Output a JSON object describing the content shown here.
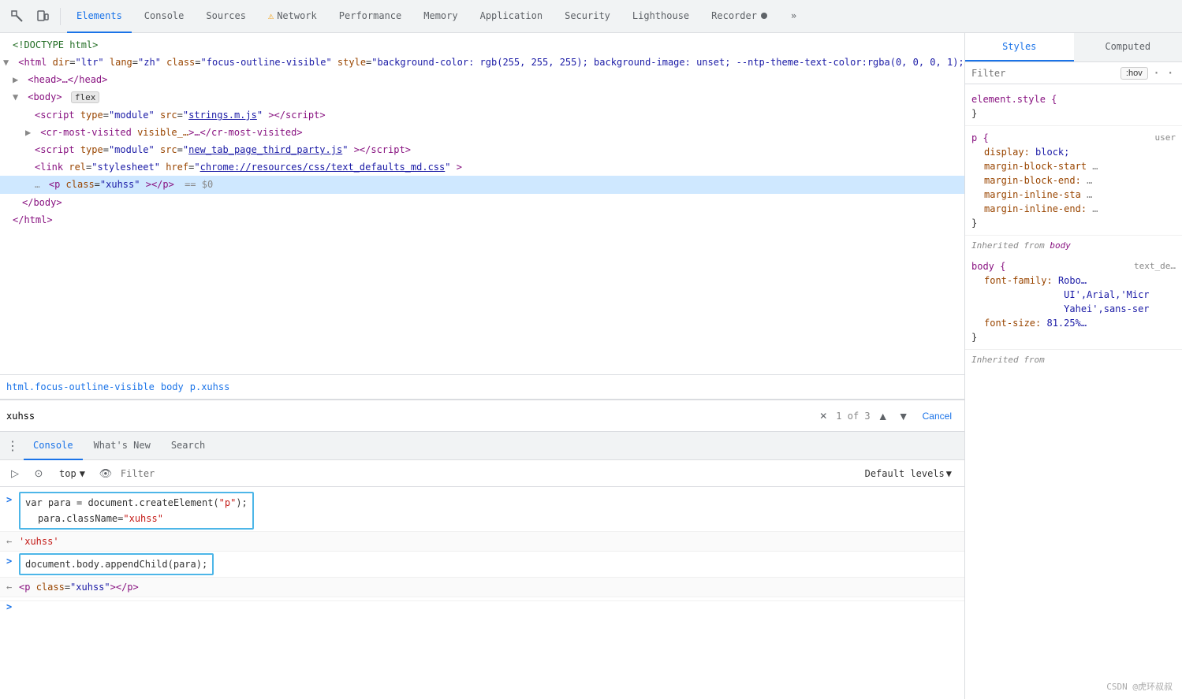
{
  "toolbar": {
    "tabs": [
      {
        "label": "Elements",
        "active": true
      },
      {
        "label": "Console",
        "active": false
      },
      {
        "label": "Sources",
        "active": false
      },
      {
        "label": "Network",
        "active": false,
        "warning": true
      },
      {
        "label": "Performance",
        "active": false
      },
      {
        "label": "Memory",
        "active": false
      },
      {
        "label": "Application",
        "active": false
      },
      {
        "label": "Security",
        "active": false
      },
      {
        "label": "Lighthouse",
        "active": false
      },
      {
        "label": "Recorder",
        "active": false
      }
    ],
    "more_label": "»"
  },
  "elements": {
    "lines": [
      {
        "id": "line1",
        "indent": 0,
        "html": "<!DOCTYPE html>",
        "type": "comment"
      },
      {
        "id": "line2",
        "indent": 0,
        "html": "html_open",
        "type": "html-open"
      },
      {
        "id": "line3",
        "indent": 1,
        "html": "head_collapsed",
        "type": "head"
      },
      {
        "id": "line4",
        "indent": 1,
        "html": "body_flex",
        "type": "body"
      },
      {
        "id": "line5",
        "indent": 2,
        "html": "script_strings",
        "type": "script"
      },
      {
        "id": "line6",
        "indent": 2,
        "html": "cr_most_visited",
        "type": "cr"
      },
      {
        "id": "line7",
        "indent": 2,
        "html": "script_third_party",
        "type": "script"
      },
      {
        "id": "line8",
        "indent": 2,
        "html": "link_stylesheet",
        "type": "link"
      },
      {
        "id": "line9",
        "indent": 2,
        "html": "p_xuhss",
        "type": "p",
        "selected": true
      },
      {
        "id": "line10",
        "indent": 1,
        "html": "body_close",
        "type": "close"
      },
      {
        "id": "line11",
        "indent": 0,
        "html": "html_close",
        "type": "close"
      }
    ]
  },
  "breadcrumb": {
    "items": [
      {
        "label": "html.focus-outline-visible"
      },
      {
        "label": "body"
      },
      {
        "label": "p.xuhss"
      }
    ]
  },
  "search": {
    "value": "xuhss",
    "count": "1 of 3",
    "cancel_label": "Cancel"
  },
  "console": {
    "tabs": [
      {
        "label": "Console",
        "active": true
      },
      {
        "label": "What's New",
        "active": false
      },
      {
        "label": "Search",
        "active": false
      }
    ],
    "context": "top",
    "filter_placeholder": "Filter",
    "default_levels": "Default levels",
    "lines": [
      {
        "type": "input",
        "prompt": ">",
        "content": "var para = document.createElement(\"p\");\n    para.className=\"xuhss\""
      },
      {
        "type": "output",
        "prompt": "←",
        "content": "'xuhss'",
        "string": true
      },
      {
        "type": "input2",
        "prompt": ">",
        "content": "document.body.appendChild(para);"
      },
      {
        "type": "output2",
        "prompt": "←",
        "content": "<p class=\"xuhss\"></p>",
        "tag": true
      },
      {
        "type": "empty",
        "prompt": ">",
        "content": ""
      }
    ]
  },
  "styles": {
    "tabs": [
      {
        "label": "Styles",
        "active": true
      },
      {
        "label": "Computed",
        "active": false
      }
    ],
    "filter_placeholder": "Filter",
    "hov_label": ":hov",
    "dot_label": "·",
    "rules": [
      {
        "selector": "element.style {",
        "close": "}",
        "props": []
      },
      {
        "selector": "p {",
        "source": "user",
        "close": "}",
        "props": [
          {
            "name": "display:",
            "value": "block;"
          },
          {
            "name": "margin-block-start:",
            "value": "..."
          },
          {
            "name": "margin-block-end:",
            "value": "..."
          },
          {
            "name": "margin-inline-sta",
            "value": "..."
          },
          {
            "name": "margin-inline-end:",
            "value": "..."
          }
        ]
      },
      {
        "inherited_label": "Inherited from",
        "inherited_from": "body"
      },
      {
        "selector": "body {",
        "source": "text_de...",
        "close": "}",
        "props": [
          {
            "name": "font-family:",
            "value": "Robo...\n          UI',Arial,'Micro\n          Yahei',sans-ser"
          },
          {
            "name": "font-size:",
            "value": "81.25%..."
          }
        ]
      },
      {
        "inherited_label": "Inherited from",
        "inherited_from": ""
      }
    ]
  },
  "watermark": "CSDN @虎环叔叔"
}
